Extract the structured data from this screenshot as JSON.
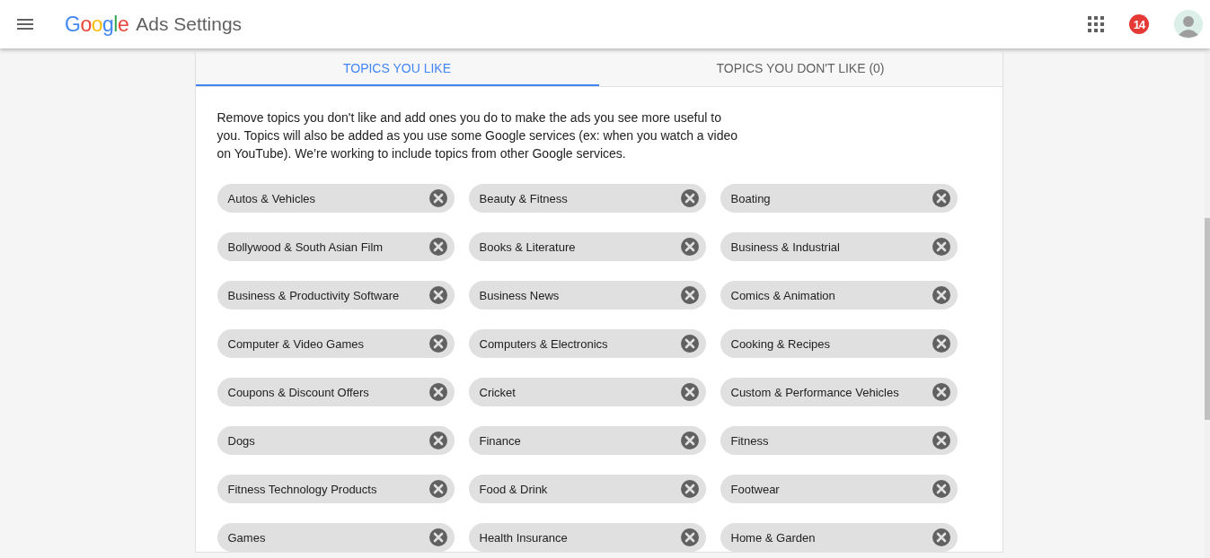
{
  "header": {
    "logo": "Google",
    "title": "Ads Settings",
    "notification_count": "14"
  },
  "tabs": [
    {
      "label": "TOPICS YOU LIKE",
      "selected": true
    },
    {
      "label": "TOPICS YOU DON'T LIKE (0)",
      "selected": false
    }
  ],
  "description": "Remove topics you don't like and add ones you do to make the ads you see more useful to you. Topics will also be added as you use some Google services (ex: when you watch a video on YouTube). We’re working to include topics from other Google services.",
  "topics": [
    "Autos & Vehicles",
    "Beauty & Fitness",
    "Boating",
    "Bollywood & South Asian Film",
    "Books & Literature",
    "Business & Industrial",
    "Business & Productivity Software",
    "Business News",
    "Comics & Animation",
    "Computer & Video Games",
    "Computers & Electronics",
    "Cooking & Recipes",
    "Coupons & Discount Offers",
    "Cricket",
    "Custom & Performance Vehicles",
    "Dogs",
    "Finance",
    "Fitness",
    "Fitness Technology Products",
    "Food & Drink",
    "Footwear",
    "Games",
    "Health Insurance",
    "Home & Garden"
  ]
}
